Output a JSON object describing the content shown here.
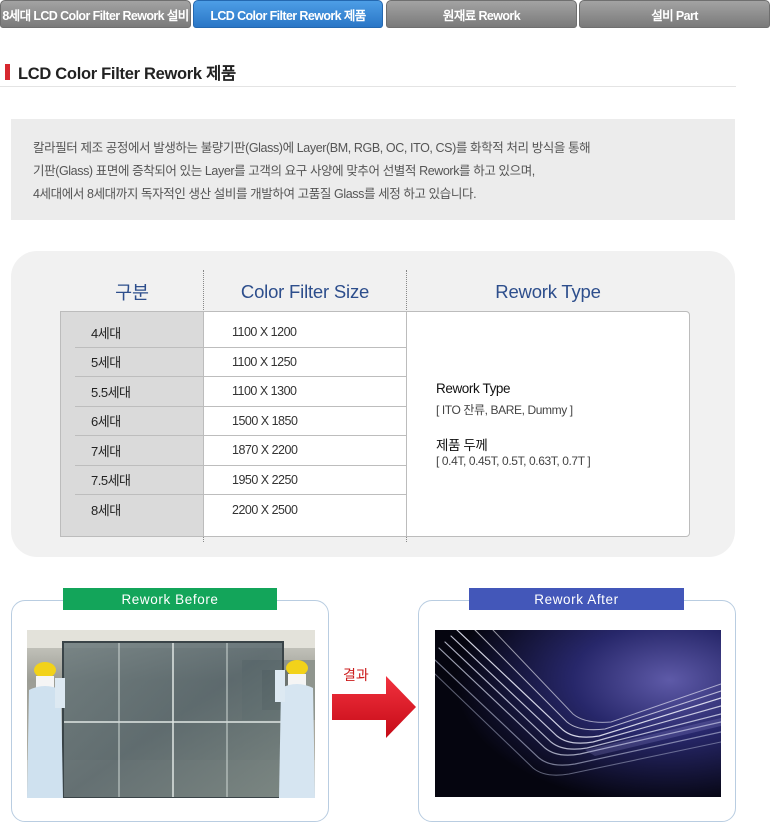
{
  "tabs": [
    {
      "label": "8세대 LCD Color Filter Rework 설비",
      "active": false
    },
    {
      "label": "LCD Color Filter Rework 제품",
      "active": true
    },
    {
      "label": "원재료 Rework",
      "active": false
    },
    {
      "label": "설비 Part",
      "active": false
    }
  ],
  "page": {
    "title": "LCD Color Filter Rework 제품"
  },
  "description": [
    "칼라필터 제조 공정에서 발생하는 불량기판(Glass)에 Layer(BM, RGB, OC, ITO, CS)를 화학적 처리 방식을 통해",
    "기판(Glass) 표면에 증착되어 있는 Layer를 고객의 요구 사양에 맞추어 선별적 Rework를 하고 있으며,",
    "4세대에서 8세대까지 독자적인 생산 설비를 개발하여 고품질 Glass를 세정 하고 있습니다."
  ],
  "spec_table": {
    "headers": {
      "category": "구분",
      "size": "Color Filter  Size",
      "type": "Rework Type"
    },
    "rows": [
      {
        "category": "4세대",
        "size": "1100 X 1200"
      },
      {
        "category": "5세대",
        "size": "1100 X 1250"
      },
      {
        "category": "5.5세대",
        "size": "1100 X 1300"
      },
      {
        "category": "6세대",
        "size": "1500 X 1850"
      },
      {
        "category": "7세대",
        "size": "1870 X 2200"
      },
      {
        "category": "7.5세대",
        "size": "1950 X 2250"
      },
      {
        "category": "8세대",
        "size": "2200 X 2500"
      }
    ],
    "type_info": [
      {
        "label": "Rework Type",
        "value": "[ ITO 잔류, BARE, Dummy ]"
      },
      {
        "label": "제품 두께",
        "value": "[ 0.4T, 0.45T, 0.5T, 0.63T, 0.7T ]"
      }
    ]
  },
  "comparison": {
    "before_label": "Rework Before",
    "after_label": "Rework After",
    "result_label": "결과"
  },
  "colors": {
    "tab_active": "#2a76c6",
    "tab_inactive": "#7a7a7a",
    "title_marker": "#d7282f",
    "header_text": "#2d4e8c",
    "before_badge": "#13a55a",
    "after_badge": "#4357b9",
    "arrow": "#e0101e"
  }
}
